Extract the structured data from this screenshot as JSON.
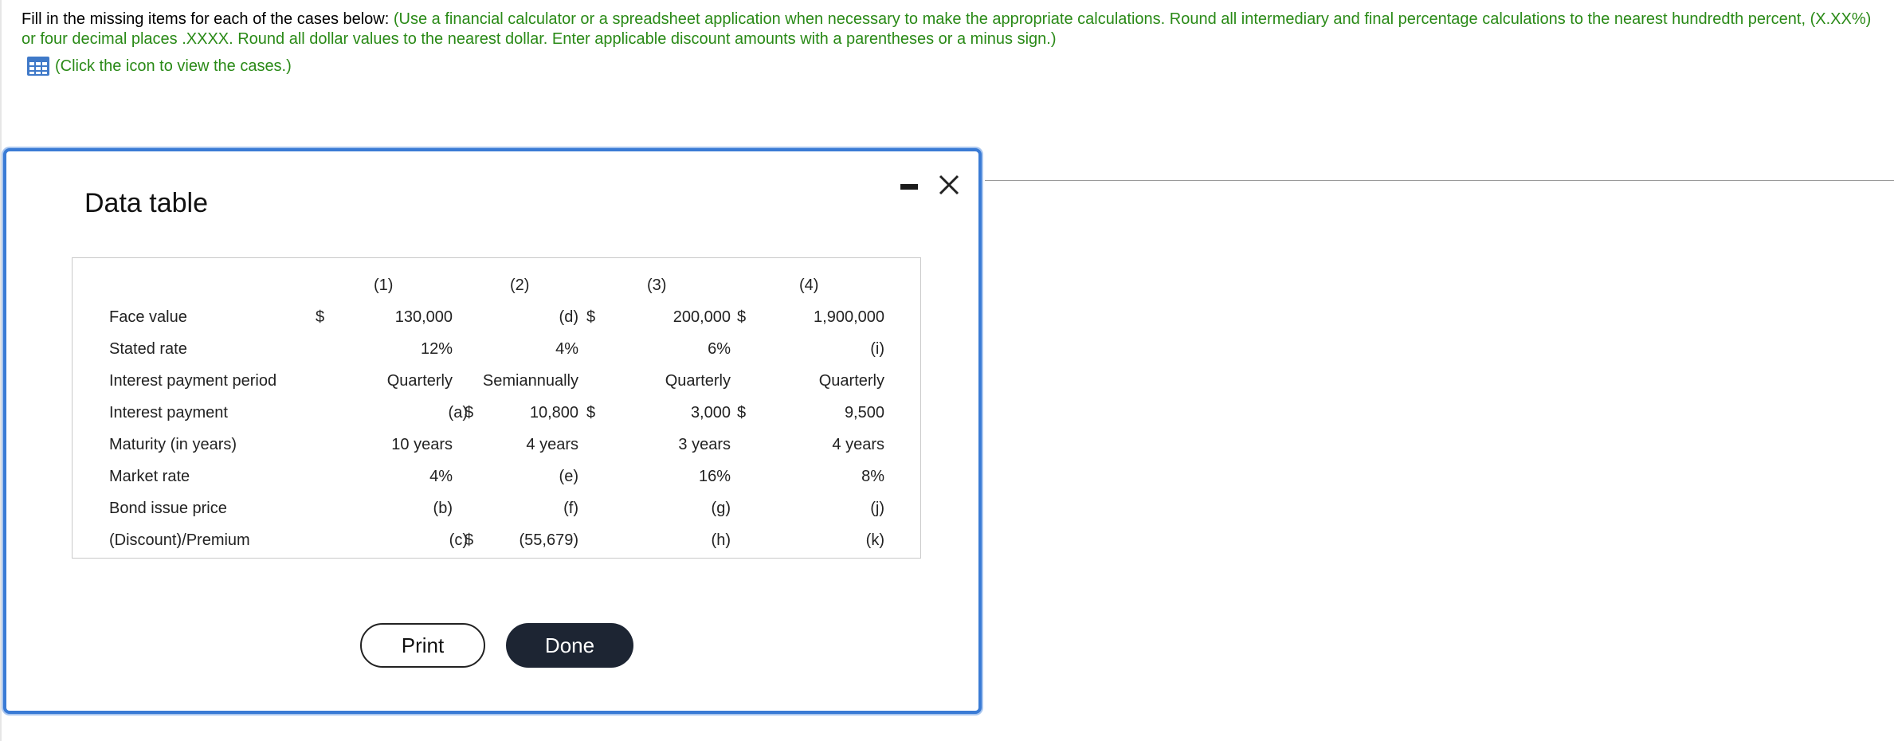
{
  "instructions": {
    "prefix": "Fill in the missing items for each of the cases below: ",
    "green": "(Use a financial calculator or a spreadsheet application when necessary to make the appropriate calculations. Round all intermediary and final percentage calculations to the nearest hundredth percent, (X.XX%) or four decimal places .XXXX. Round all dollar values to the nearest dollar. Enter applicable discount amounts with a parentheses or a minus sign.)"
  },
  "cases_link": {
    "label": "(Click the icon to view the cases.)",
    "icon": "table-grid-icon"
  },
  "dialog": {
    "title": "Data table",
    "print_label": "Print",
    "done_label": "Done",
    "minimize_icon": "minimize-icon",
    "close_icon": "close-icon"
  },
  "table": {
    "headers": [
      "(1)",
      "(2)",
      "(3)",
      "(4)"
    ],
    "dollar": "$",
    "rows": [
      {
        "label": "Face value",
        "c1": "130,000",
        "c2": "(d)",
        "c3": "200,000",
        "c4": "1,900,000"
      },
      {
        "label": "Stated rate",
        "c1": "12%",
        "c2": "4%",
        "c3": "6%",
        "c4": "(i)"
      },
      {
        "label": "Interest payment period",
        "c1": "Quarterly",
        "c2": "Semiannually",
        "c3": "Quarterly",
        "c4": "Quarterly"
      },
      {
        "label": "Interest payment",
        "c1": "(a)",
        "c2": "10,800",
        "c3": "3,000",
        "c4": "9,500"
      },
      {
        "label": "Maturity (in years)",
        "c1": "10 years",
        "c2": "4 years",
        "c3": "3 years",
        "c4": "4 years"
      },
      {
        "label": "Market rate",
        "c1": "4%",
        "c2": "(e)",
        "c3": "16%",
        "c4": "8%"
      },
      {
        "label": "Bond issue price",
        "c1": "(b)",
        "c2": "(f)",
        "c3": "(g)",
        "c4": "(j)"
      },
      {
        "label": "(Discount)/Premium",
        "c1": "(c)",
        "c2": "(55,679)",
        "c3": "(h)",
        "c4": "(k)"
      }
    ]
  }
}
